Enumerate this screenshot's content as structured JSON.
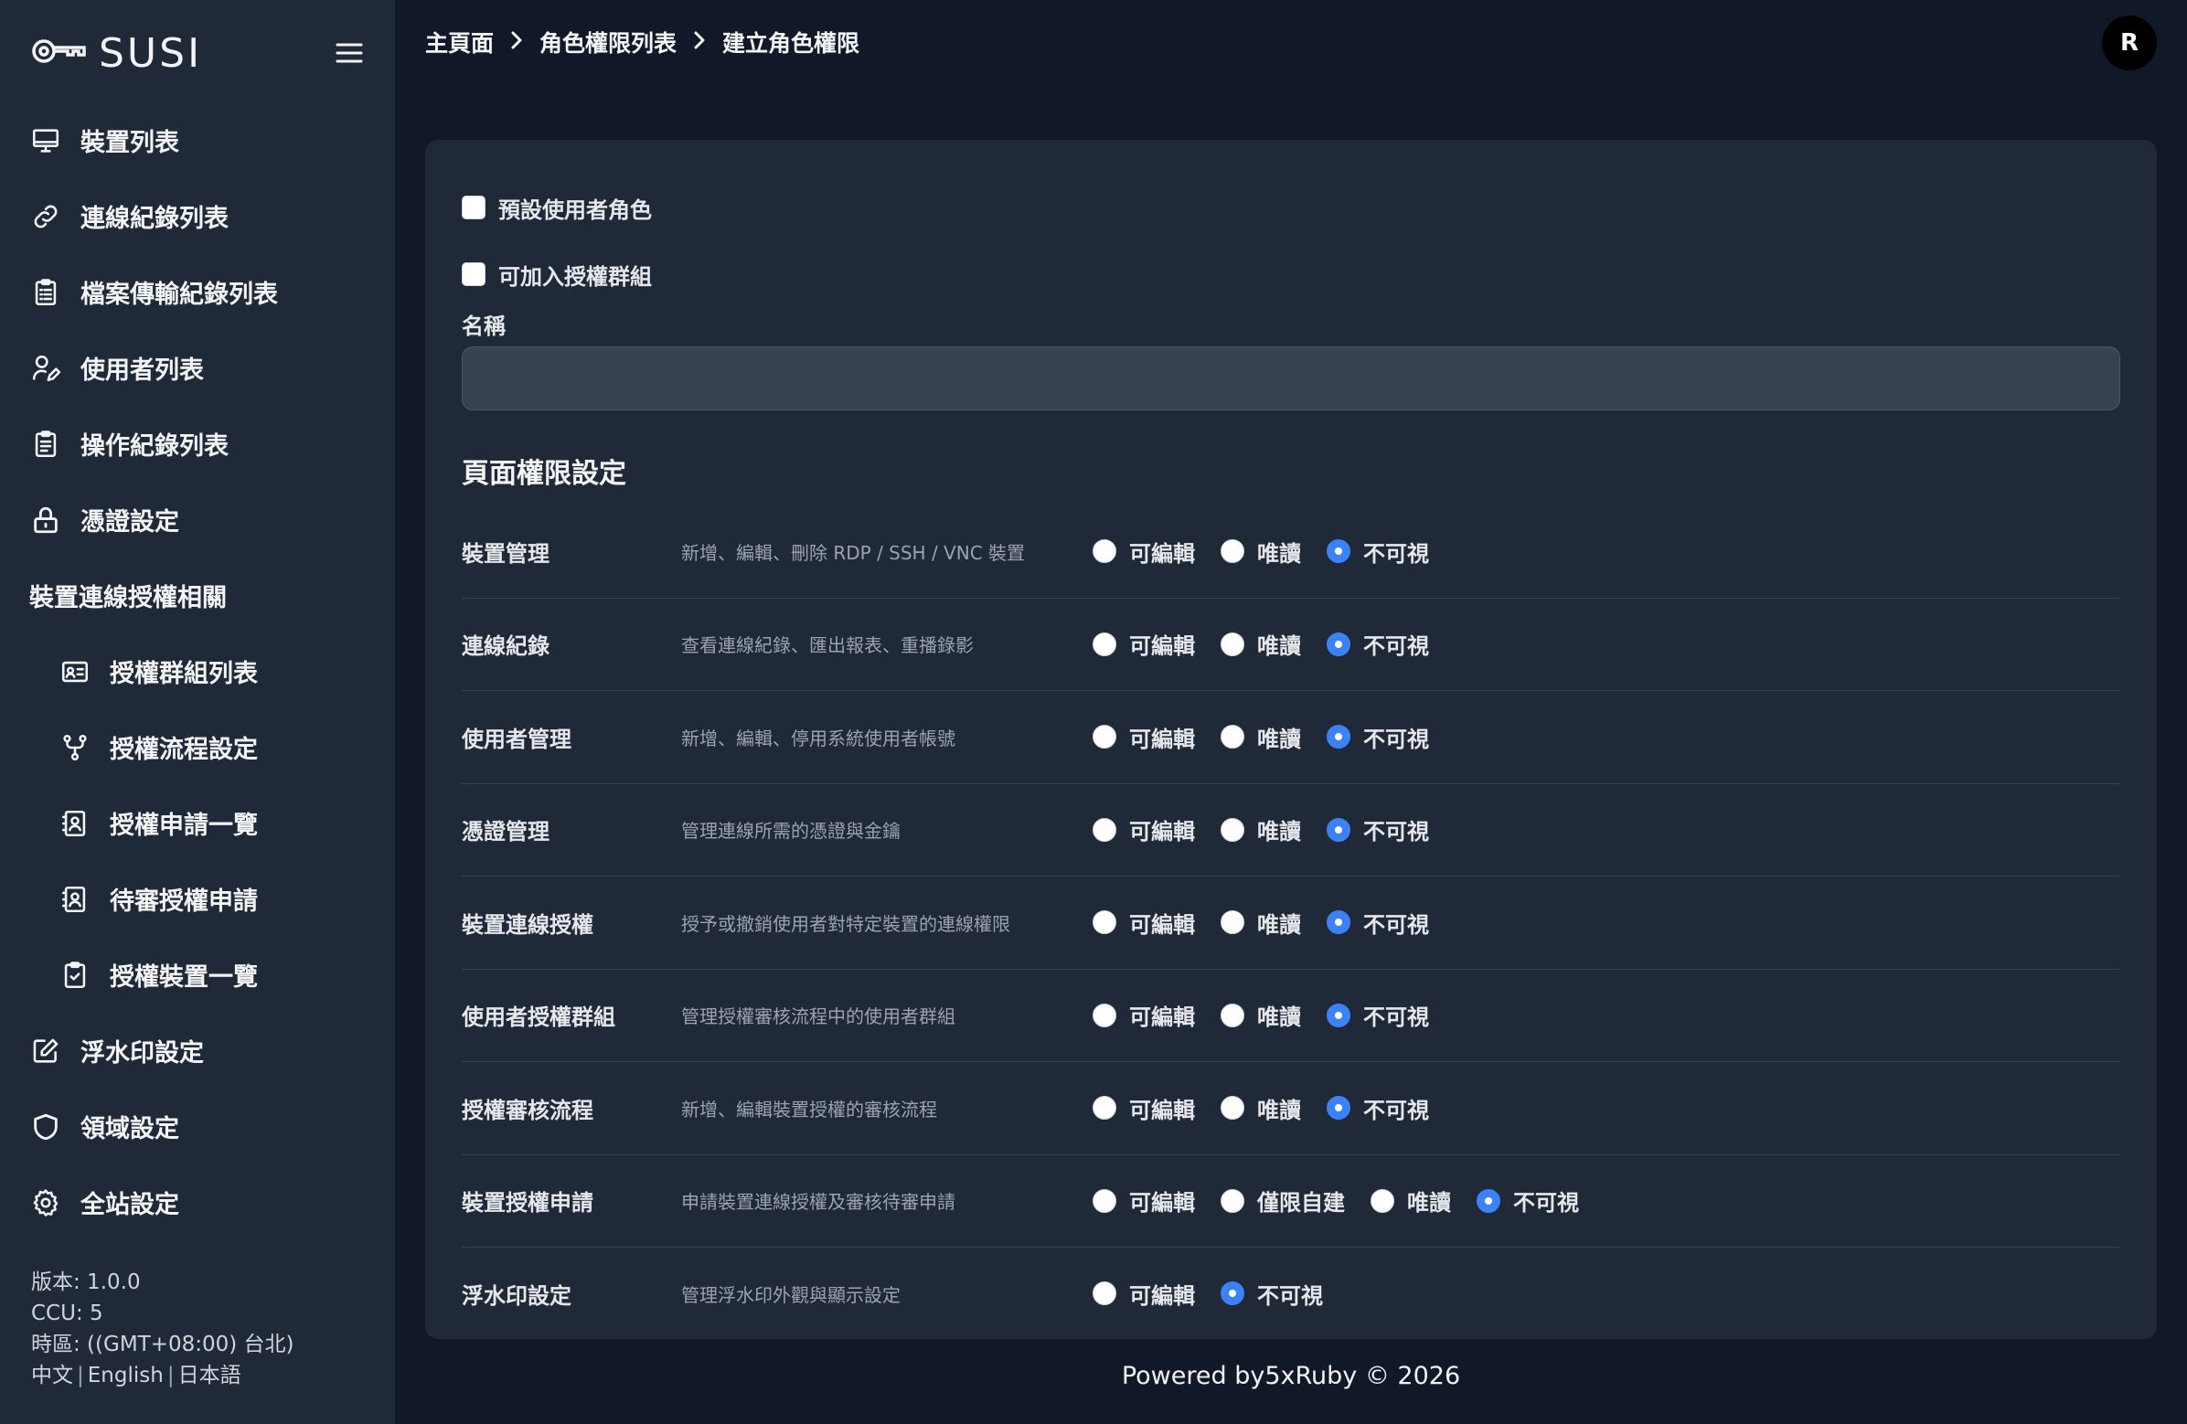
{
  "app": {
    "logo_text": "SUSI"
  },
  "sidebar": {
    "items": [
      {
        "label": "裝置列表",
        "icon": "monitor-icon",
        "sub": false
      },
      {
        "label": "連線紀錄列表",
        "icon": "link-icon",
        "sub": false
      },
      {
        "label": "檔案傳輸紀錄列表",
        "icon": "clipboard-list-icon",
        "sub": false
      },
      {
        "label": "使用者列表",
        "icon": "user-edit-icon",
        "sub": false
      },
      {
        "label": "操作紀錄列表",
        "icon": "clipboard-icon",
        "sub": false
      },
      {
        "label": "憑證設定",
        "icon": "lock-icon",
        "sub": false
      },
      {
        "label": "裝置連線授權相關",
        "icon": "",
        "sub": false,
        "group": true
      },
      {
        "label": "授權群組列表",
        "icon": "id-card-icon",
        "sub": true
      },
      {
        "label": "授權流程設定",
        "icon": "git-fork-icon",
        "sub": true
      },
      {
        "label": "授權申請一覽",
        "icon": "contact-book-icon",
        "sub": true
      },
      {
        "label": "待審授權申請",
        "icon": "contact-book-icon",
        "sub": true
      },
      {
        "label": "授權裝置一覽",
        "icon": "clipboard-check-icon",
        "sub": true
      },
      {
        "label": "浮水印設定",
        "icon": "edit-square-icon",
        "sub": false
      },
      {
        "label": "領域設定",
        "icon": "shield-icon",
        "sub": false
      },
      {
        "label": "全站設定",
        "icon": "gear-icon",
        "sub": false
      }
    ],
    "footer": {
      "version": "版本: 1.0.0",
      "ccu": "CCU: 5",
      "timezone": "時區: ((GMT+08:00) 台北)",
      "langs": [
        "中文",
        "English",
        "日本語"
      ]
    }
  },
  "breadcrumb": [
    "主頁面",
    "角色權限列表",
    "建立角色權限"
  ],
  "avatar": {
    "initial": "R"
  },
  "form": {
    "default_role_label": "預設使用者角色",
    "joinable_group_label": "可加入授權群組",
    "name_label": "名稱",
    "name_value": "",
    "name_placeholder": "",
    "section_title": "頁面權限設定",
    "permissions": [
      {
        "name": "裝置管理",
        "desc": "新增、編輯、刪除 RDP / SSH / VNC 裝置",
        "options": [
          "可編輯",
          "唯讀",
          "不可視"
        ],
        "selected": 2
      },
      {
        "name": "連線紀錄",
        "desc": "查看連線紀錄、匯出報表、重播錄影",
        "options": [
          "可編輯",
          "唯讀",
          "不可視"
        ],
        "selected": 2
      },
      {
        "name": "使用者管理",
        "desc": "新增、編輯、停用系統使用者帳號",
        "options": [
          "可編輯",
          "唯讀",
          "不可視"
        ],
        "selected": 2
      },
      {
        "name": "憑證管理",
        "desc": "管理連線所需的憑證與金鑰",
        "options": [
          "可編輯",
          "唯讀",
          "不可視"
        ],
        "selected": 2
      },
      {
        "name": "裝置連線授權",
        "desc": "授予或撤銷使用者對特定裝置的連線權限",
        "options": [
          "可編輯",
          "唯讀",
          "不可視"
        ],
        "selected": 2
      },
      {
        "name": "使用者授權群組",
        "desc": "管理授權審核流程中的使用者群組",
        "options": [
          "可編輯",
          "唯讀",
          "不可視"
        ],
        "selected": 2
      },
      {
        "name": "授權審核流程",
        "desc": "新增、編輯裝置授權的審核流程",
        "options": [
          "可編輯",
          "唯讀",
          "不可視"
        ],
        "selected": 2
      },
      {
        "name": "裝置授權申請",
        "desc": "申請裝置連線授權及審核待審申請",
        "options": [
          "可編輯",
          "僅限自建",
          "唯讀",
          "不可視"
        ],
        "selected": 3
      },
      {
        "name": "浮水印設定",
        "desc": "管理浮水印外觀與顯示設定",
        "options": [
          "可編輯",
          "不可視"
        ],
        "selected": 1
      }
    ]
  },
  "footer": {
    "text": "Powered by5xRuby © 2026"
  },
  "colors": {
    "page_bg": "#111827",
    "panel_bg": "#1f2937",
    "accent": "#3b82f6"
  }
}
